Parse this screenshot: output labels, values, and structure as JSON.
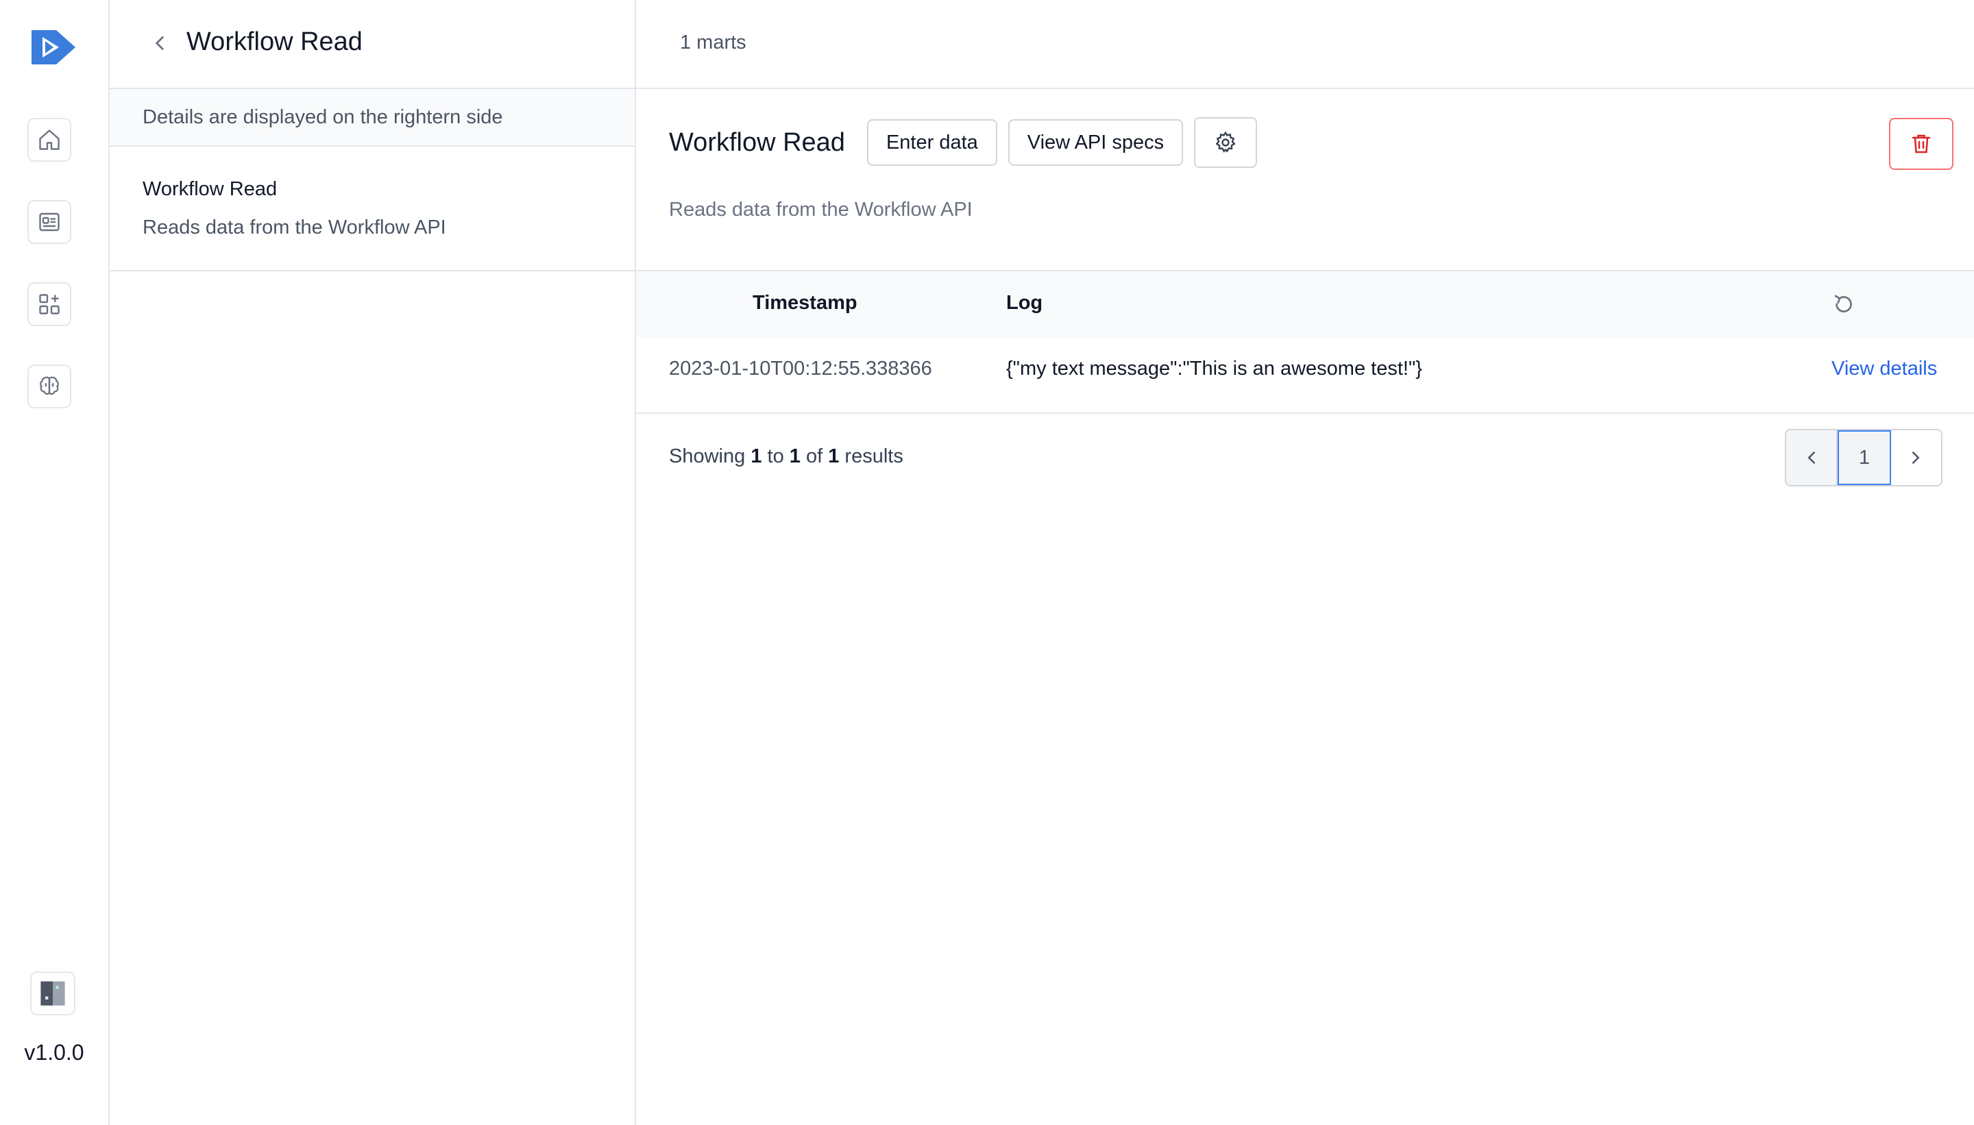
{
  "rail": {
    "icons": [
      "logo-icon",
      "home-icon",
      "id-card-icon",
      "widgets-add-icon",
      "brain-icon"
    ],
    "version": "v1.0.0"
  },
  "sidebar": {
    "title": "Workflow Read",
    "info": "Details are displayed on the rightern side",
    "item": {
      "name": "Workflow Read",
      "description": "Reads data from the Workflow API"
    }
  },
  "main": {
    "mart_count": "1 marts",
    "title": "Workflow Read",
    "enter_data_label": "Enter data",
    "api_specs_label": "View API specs",
    "description": "Reads data from the Workflow API",
    "table": {
      "headers": [
        "Timestamp",
        "Log"
      ],
      "rows": [
        {
          "timestamp": "2023-01-10T00:12:55.338366",
          "log": "{\"my text message\":\"This is an awesome test!\"}",
          "action": "View details"
        }
      ]
    },
    "results": {
      "prefix": "Showing",
      "from": "1",
      "to_word": "to",
      "to": "1",
      "of_word": "of",
      "total": "1",
      "suffix": "results"
    },
    "pagination": {
      "current_page": "1"
    }
  },
  "colors": {
    "brand": "#3b7ddd",
    "link": "#2563eb",
    "danger": "#dc2626"
  }
}
